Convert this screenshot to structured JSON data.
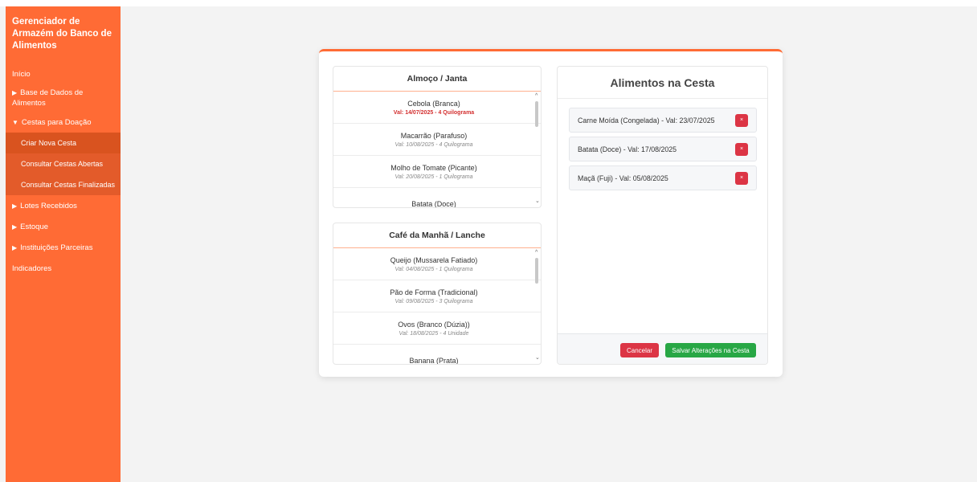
{
  "sidebar": {
    "brand": "Gerenciador de Armazém do Banco de Alimentos",
    "items": [
      {
        "label": "Início",
        "arrow": ""
      },
      {
        "label": "Base de Dados de Alimentos",
        "arrow": "▶"
      },
      {
        "label": "Cestas para Doação",
        "arrow": "▼"
      }
    ],
    "subitems": [
      {
        "label": "Criar Nova Cesta"
      },
      {
        "label": "Consultar Cestas Abertas"
      },
      {
        "label": "Consultar Cestas Finalizadas"
      }
    ],
    "items_after": [
      {
        "label": "Lotes Recebidos",
        "arrow": "▶"
      },
      {
        "label": "Estoque",
        "arrow": "▶"
      },
      {
        "label": "Instituições Parceiras",
        "arrow": "▶"
      },
      {
        "label": "Indicadores",
        "arrow": ""
      }
    ]
  },
  "lunch": {
    "title": "Almoço / Janta",
    "items": [
      {
        "name": "Cebola (Branca)",
        "meta": "Val: 14/07/2025 - 4 Quilograma"
      },
      {
        "name": "Macarrão (Parafuso)",
        "meta": "Val: 10/08/2025 - 4 Quilograma"
      },
      {
        "name": "Molho de Tomate (Picante)",
        "meta": "Val: 20/08/2025 - 1 Quilograma"
      },
      {
        "name": "Batata (Doce)",
        "meta": ""
      }
    ]
  },
  "breakfast": {
    "title": "Café da Manhã / Lanche",
    "items": [
      {
        "name": "Queijo (Mussarela Fatiado)",
        "meta": "Val: 04/08/2025 - 1 Quilograma"
      },
      {
        "name": "Pão de Forma (Tradicional)",
        "meta": "Val: 09/08/2025 - 3 Quilograma"
      },
      {
        "name": "Ovos (Branco (Dúzia))",
        "meta": "Val: 18/08/2025 - 4 Unidade"
      },
      {
        "name": "Banana (Prata)",
        "meta": ""
      }
    ]
  },
  "basket": {
    "title": "Alimentos na Cesta",
    "items": [
      {
        "label": "Carne Moída (Congelada) - Val: 23/07/2025"
      },
      {
        "label": "Batata (Doce) - Val: 17/08/2025"
      },
      {
        "label": "Maçã (Fuji) - Val: 05/08/2025"
      }
    ],
    "remove_glyph": "×",
    "cancel_label": "Cancelar",
    "save_label": "Salvar Alterações na Cesta"
  },
  "scroll": {
    "up": "^",
    "down": "⌄"
  }
}
